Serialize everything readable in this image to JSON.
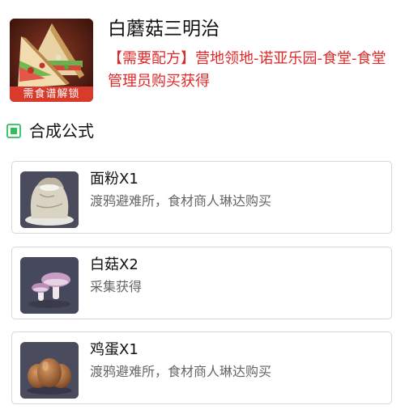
{
  "recipe": {
    "name": "白蘑菇三明治",
    "source": "【需要配方】营地领地-诺亚乐园-食堂-食堂管理员购买获得",
    "lock_label": "需食谱解锁",
    "image_icon": "sandwich-icon"
  },
  "formula": {
    "title": "合成公式",
    "icon": "green-square-icon",
    "ingredients": [
      {
        "name": "面粉X1",
        "source": "渡鸦避难所，食材商人琳达购买",
        "icon": "flour-sack-icon"
      },
      {
        "name": "白菇X2",
        "source": "采集获得",
        "icon": "mushroom-icon"
      },
      {
        "name": "鸡蛋X1",
        "source": "渡鸦避难所，食材商人琳达购买",
        "icon": "eggs-icon"
      }
    ]
  },
  "colors": {
    "source_text": "#e02828",
    "lock_banner": "#d83a2b",
    "section_icon": "#2fbf5a",
    "card_border": "#d7d7d7"
  }
}
